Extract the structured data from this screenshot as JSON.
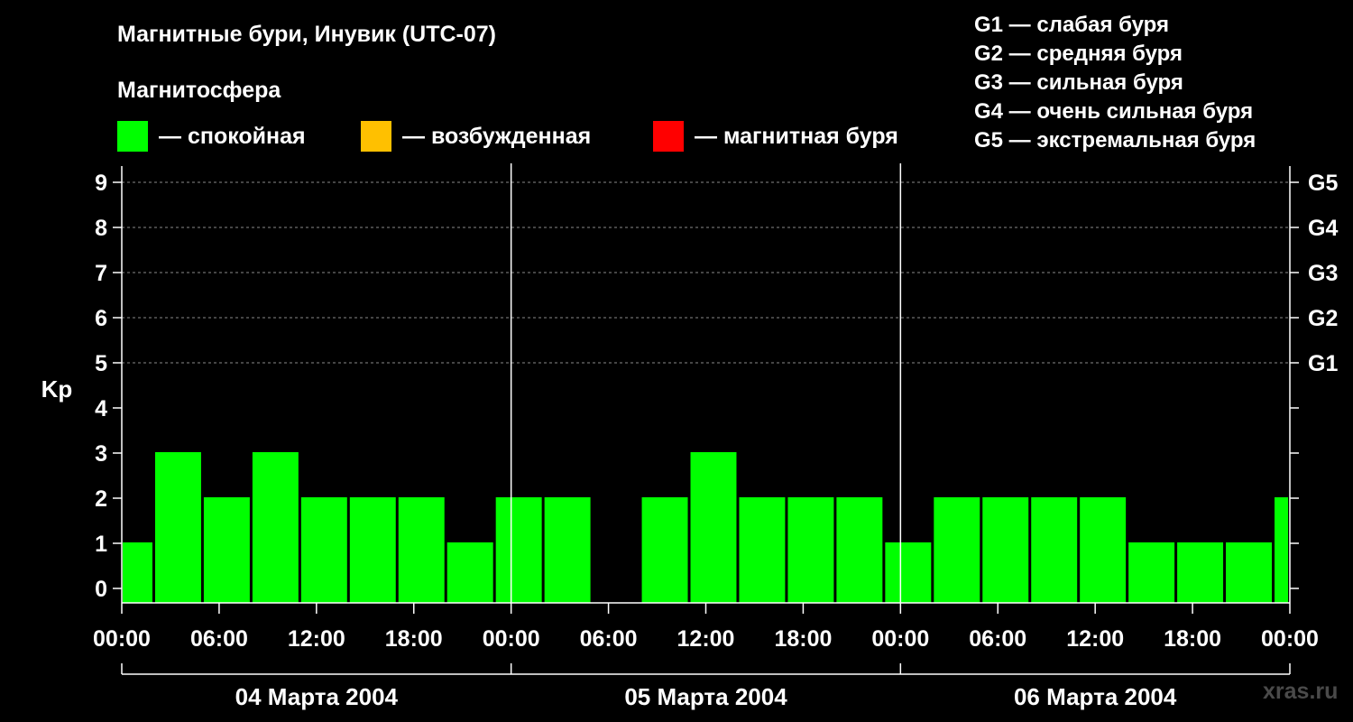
{
  "header": {
    "title": "Магнитные бури, Инувик (UTC-07)",
    "subtitle": "Магнитосфера"
  },
  "legend": [
    {
      "label": "— спокойная",
      "color": "#00ff00"
    },
    {
      "label": "— возбужденная",
      "color": "#ffc000"
    },
    {
      "label": "— магнитная буря",
      "color": "#ff0000"
    }
  ],
  "storm_scale": [
    "G1 — слабая буря",
    "G2 — средняя буря",
    "G3 — сильная буря",
    "G4 — очень сильная буря",
    "G5 — экстремальная буря"
  ],
  "watermark": "xras.ru",
  "chart_data": {
    "type": "bar",
    "ylabel": "Kp",
    "ylim": [
      0,
      9
    ],
    "yticks": [
      0,
      1,
      2,
      3,
      4,
      5,
      6,
      7,
      8,
      9
    ],
    "right_axis_labels": [
      {
        "kp": 5,
        "label": "G1"
      },
      {
        "kp": 6,
        "label": "G2"
      },
      {
        "kp": 7,
        "label": "G3"
      },
      {
        "kp": 8,
        "label": "G4"
      },
      {
        "kp": 9,
        "label": "G5"
      }
    ],
    "x_tick_labels": [
      "00:00",
      "06:00",
      "12:00",
      "18:00",
      "00:00",
      "06:00",
      "12:00",
      "18:00",
      "00:00",
      "06:00",
      "12:00",
      "18:00",
      "00:00"
    ],
    "days": [
      "04 Марта 2004",
      "05 Марта 2004",
      "06 Марта 2004"
    ],
    "grid": "dashed horizontal at 5-9",
    "bar_color": "#00ff00",
    "bars": [
      {
        "start": "04 Марта 2004 00:00",
        "end": "04 Марта 2004 02:00",
        "kp": 1
      },
      {
        "start": "04 Марта 2004 02:00",
        "end": "04 Марта 2004 05:00",
        "kp": 3
      },
      {
        "start": "04 Марта 2004 05:00",
        "end": "04 Марта 2004 08:00",
        "kp": 2
      },
      {
        "start": "04 Марта 2004 08:00",
        "end": "04 Марта 2004 11:00",
        "kp": 3
      },
      {
        "start": "04 Марта 2004 11:00",
        "end": "04 Марта 2004 14:00",
        "kp": 2
      },
      {
        "start": "04 Марта 2004 14:00",
        "end": "04 Марта 2004 17:00",
        "kp": 2
      },
      {
        "start": "04 Марта 2004 17:00",
        "end": "04 Марта 2004 20:00",
        "kp": 2
      },
      {
        "start": "04 Марта 2004 20:00",
        "end": "04 Марта 2004 23:00",
        "kp": 1
      },
      {
        "start": "04 Марта 2004 23:00",
        "end": "05 Марта 2004 02:00",
        "kp": 2
      },
      {
        "start": "05 Марта 2004 02:00",
        "end": "05 Марта 2004 05:00",
        "kp": 2
      },
      {
        "start": "05 Марта 2004 05:00",
        "end": "05 Марта 2004 08:00",
        "kp": 0
      },
      {
        "start": "05 Марта 2004 08:00",
        "end": "05 Марта 2004 11:00",
        "kp": 2
      },
      {
        "start": "05 Марта 2004 11:00",
        "end": "05 Марта 2004 14:00",
        "kp": 3
      },
      {
        "start": "05 Марта 2004 14:00",
        "end": "05 Марта 2004 17:00",
        "kp": 2
      },
      {
        "start": "05 Марта 2004 17:00",
        "end": "05 Марта 2004 20:00",
        "kp": 2
      },
      {
        "start": "05 Марта 2004 20:00",
        "end": "05 Марта 2004 23:00",
        "kp": 2
      },
      {
        "start": "05 Марта 2004 23:00",
        "end": "06 Марта 2004 02:00",
        "kp": 1
      },
      {
        "start": "06 Марта 2004 02:00",
        "end": "06 Марта 2004 05:00",
        "kp": 2
      },
      {
        "start": "06 Марта 2004 05:00",
        "end": "06 Марта 2004 08:00",
        "kp": 2
      },
      {
        "start": "06 Марта 2004 08:00",
        "end": "06 Марта 2004 11:00",
        "kp": 2
      },
      {
        "start": "06 Марта 2004 11:00",
        "end": "06 Марта 2004 14:00",
        "kp": 2
      },
      {
        "start": "06 Марта 2004 14:00",
        "end": "06 Марта 2004 17:00",
        "kp": 1
      },
      {
        "start": "06 Марта 2004 17:00",
        "end": "06 Марта 2004 20:00",
        "kp": 1
      },
      {
        "start": "06 Марта 2004 20:00",
        "end": "06 Марта 2004 23:00",
        "kp": 1
      },
      {
        "start": "06 Марта 2004 23:00",
        "end": "07 Марта 2004 00:00",
        "kp": 2
      }
    ]
  }
}
